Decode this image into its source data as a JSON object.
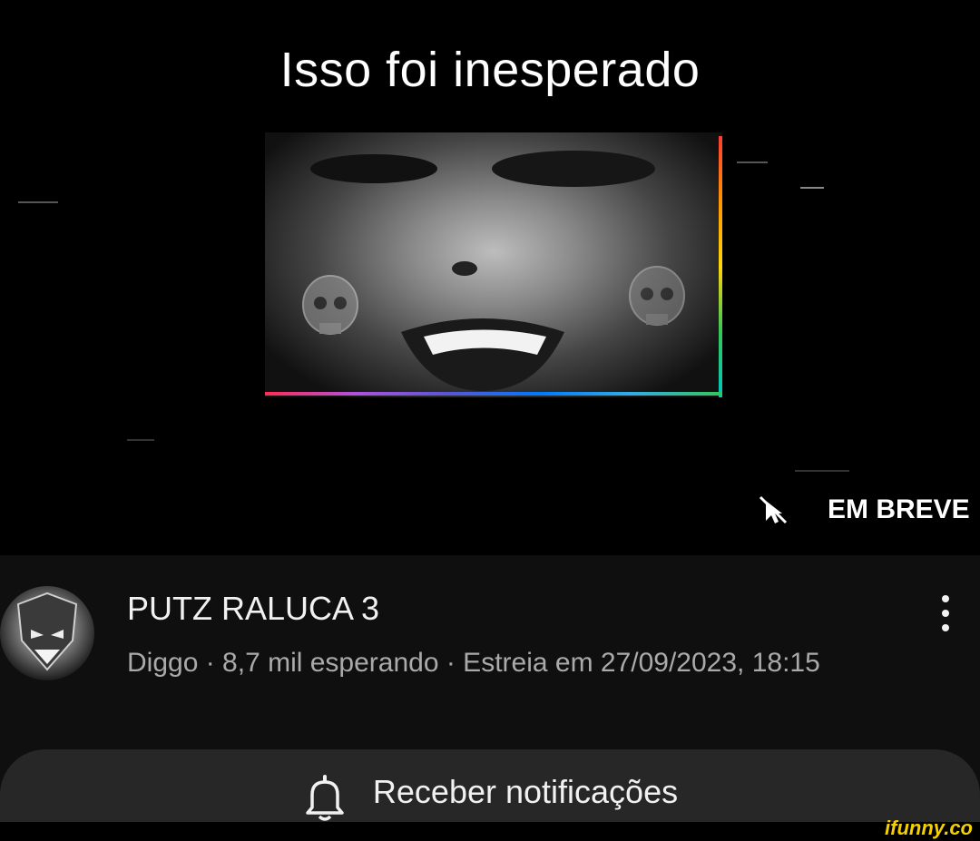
{
  "thumbnail": {
    "title_text": "Isso foi inesperado",
    "coming_soon_label": "EM BREVE",
    "rainbow_colors": [
      "#ff3b30",
      "#ff9500",
      "#ffd60a",
      "#34c759",
      "#007aff",
      "#af52de"
    ]
  },
  "video": {
    "title": "PUTZ RALUCA 3",
    "subtitle": "Diggo · 8,7 mil esperando · Estreia em 27/09/2023, 18:15"
  },
  "actions": {
    "notify_label": "Receber notificações"
  },
  "watermark": {
    "text": "ifunny.co"
  },
  "colors": {
    "background": "#0f0f0f",
    "button_bg": "#272727",
    "secondary_text": "#aaaaaa",
    "watermark": "#f5d000"
  }
}
